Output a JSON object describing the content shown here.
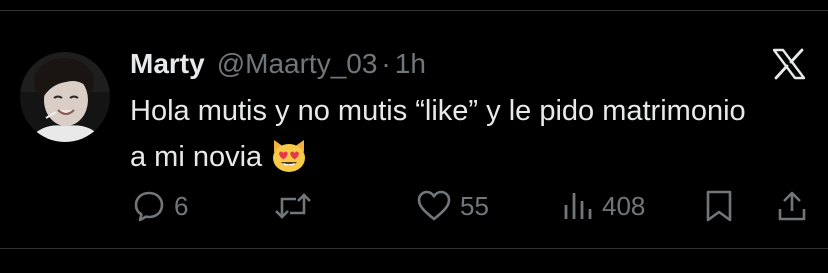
{
  "tweet": {
    "author_name": "Marty",
    "handle": "@Maarty_03",
    "separator": "·",
    "time": "1h",
    "text": "Hola mutis y no mutis “like” y le pido matrimonio a mi novia",
    "emoji": "smiling-cat-heart-eyes-emoji"
  },
  "actions": {
    "replies": "6",
    "reposts": "",
    "likes": "55",
    "views": "408"
  },
  "icons": {
    "reply": "reply-icon",
    "repost": "repost-icon",
    "like": "heart-icon",
    "views": "views-icon",
    "bookmark": "bookmark-icon",
    "share": "share-icon",
    "brand": "x-logo-icon"
  },
  "colors": {
    "background": "#000000",
    "text": "#e7e9ea",
    "secondary": "#71767b",
    "divider": "#2f3336"
  }
}
